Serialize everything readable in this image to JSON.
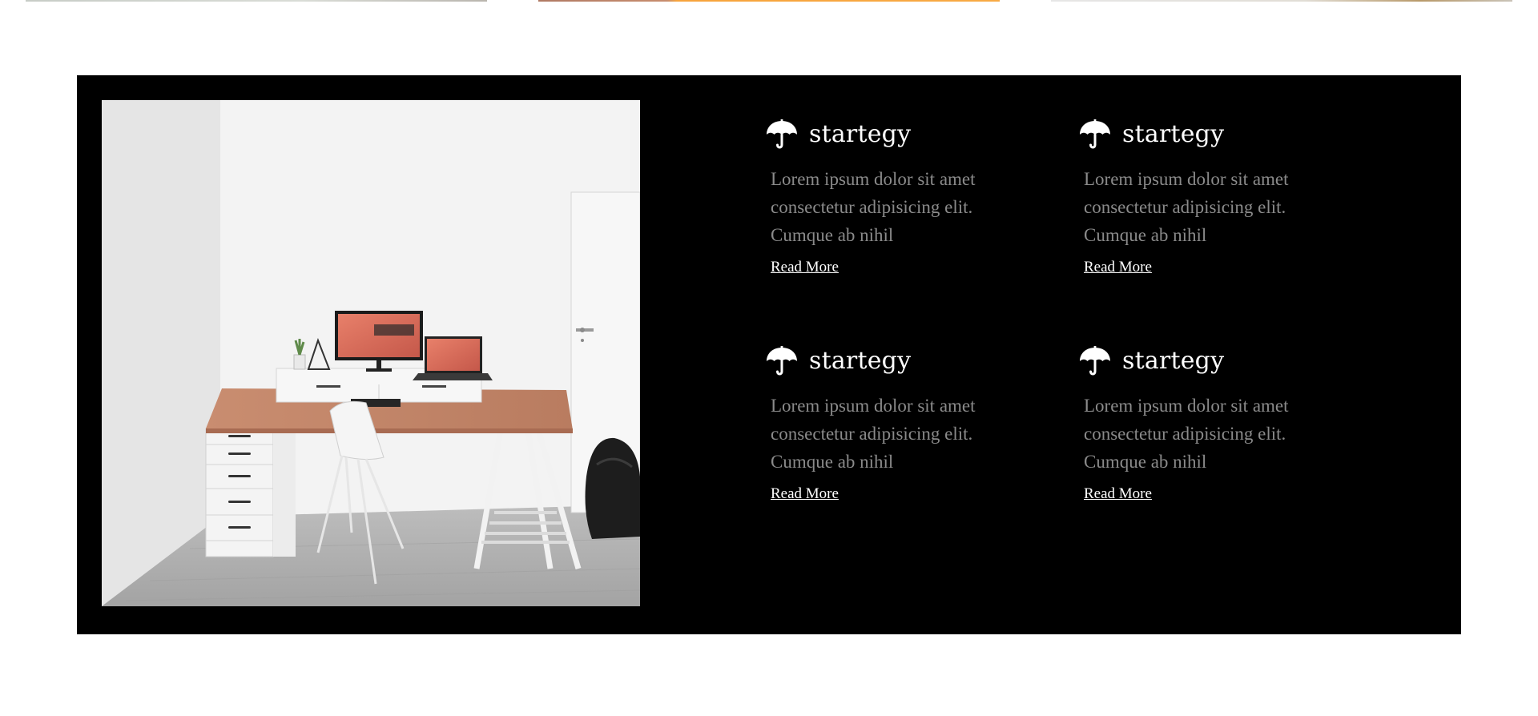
{
  "features": [
    {
      "title": "startegy",
      "text": "Lorem ipsum dolor sit amet consectetur adipisicing elit. Cumque ab nihil",
      "link": "Read More",
      "icon": "umbrella-icon"
    },
    {
      "title": "startegy",
      "text": "Lorem ipsum dolor sit amet consectetur adipisicing elit. Cumque ab nihil",
      "link": "Read More",
      "icon": "umbrella-icon"
    },
    {
      "title": "startegy",
      "text": "Lorem ipsum dolor sit amet consectetur adipisicing elit. Cumque ab nihil",
      "link": "Read More",
      "icon": "umbrella-icon"
    },
    {
      "title": "startegy",
      "text": "Lorem ipsum dolor sit amet consectetur adipisicing elit. Cumque ab nihil",
      "link": "Read More",
      "icon": "umbrella-icon"
    }
  ],
  "colors": {
    "panel_background": "#000000",
    "page_background": "#ffffff",
    "title": "#ffffff",
    "body_text": "#8a8a8a",
    "link": "#ffffff"
  }
}
